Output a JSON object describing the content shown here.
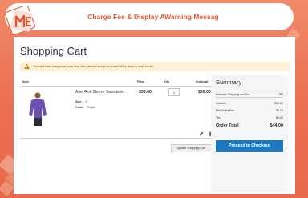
{
  "banner": {
    "title": "Charge Fee & Display AWarning Messag"
  },
  "page": {
    "title": "Shopping Cart"
  },
  "warning": {
    "text": "You have been charged min order fees. Your cart total should be at least $40 or above to avoid the fee."
  },
  "cart": {
    "headers": {
      "item": "Item",
      "price": "Price",
      "qty": "Qty",
      "subtotal": "Subtotal"
    },
    "items": [
      {
        "name": "Ariel Roll Sleeve Sweatshirt",
        "size_label": "Size:",
        "size_value": "S",
        "color_label": "Color:",
        "color_value": "Purple",
        "price": "$39.00",
        "qty": "1",
        "subtotal": "$39.00"
      }
    ],
    "update_label": "Update Shopping Cart"
  },
  "summary": {
    "title": "Summary",
    "estimate_label": "Estimate Shipping and Tax",
    "rows": [
      {
        "label": "Subtotal",
        "value": "$39.00"
      },
      {
        "label": "Min Order Fee",
        "value": "$5.00"
      },
      {
        "label": "Tax",
        "value": "$0.00"
      }
    ],
    "total_label": "Order Total",
    "total_value": "$44.00",
    "checkout_label": "Proceed to Checkout"
  },
  "colors": {
    "brand": "#e5532f",
    "accent": "#1979c3",
    "warning_bg": "#fdf0d5"
  },
  "icons": [
    "logo-icon",
    "warning-icon",
    "chevron-down-icon",
    "edit-icon",
    "trash-icon"
  ]
}
